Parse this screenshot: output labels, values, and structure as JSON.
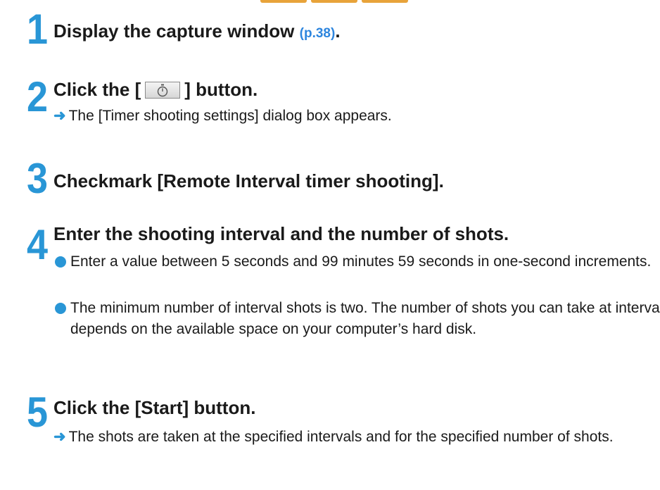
{
  "steps": [
    {
      "number": "1",
      "title": "Display the capture window",
      "page_ref": "(p.38)",
      "title_suffix": "."
    },
    {
      "number": "2",
      "title_prefix": "Click the [",
      "title_suffix": "] button.",
      "button_icon": "timer-icon",
      "result": "The [Timer shooting settings] dialog box appears."
    },
    {
      "number": "3",
      "title": "Checkmark [Remote Interval timer shooting]."
    },
    {
      "number": "4",
      "title": "Enter the shooting interval and the number of shots.",
      "bullets": [
        "Enter a value between 5 seconds and 99 minutes 59 seconds in one-second increments.",
        "The minimum number of interval shots is two. The number of shots you can take at intervals depends on the available space on your computer’s hard disk."
      ]
    },
    {
      "number": "5",
      "title": "Click the [Start] button.",
      "result": "The shots are taken at the specified intervals and for the specified number of shots."
    }
  ],
  "colors": {
    "accent": "#2996d6",
    "link": "#2e86de",
    "tab": "#e8a33a"
  }
}
